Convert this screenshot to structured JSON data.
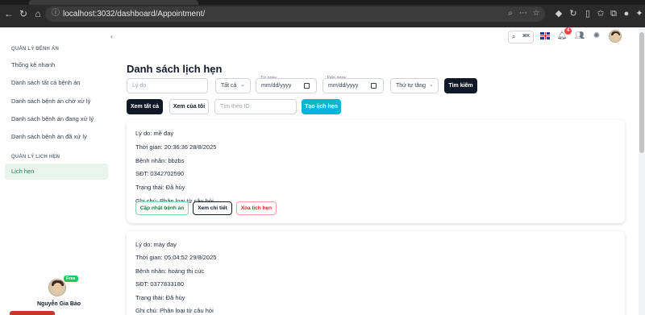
{
  "browser": {
    "url": "localhost:3032/dashboard/Appointment/"
  },
  "sidebar": {
    "sections": [
      {
        "title": "QUẢN LÝ BỆNH ÁN",
        "items": [
          {
            "label": "Thống kê nhanh"
          },
          {
            "label": "Danh sách tất cả bệnh án"
          },
          {
            "label": "Danh sách bệnh án chờ xử lý"
          },
          {
            "label": "Danh sách bệnh án đang xử lý"
          },
          {
            "label": "Danh sách bệnh án đã xử lý"
          }
        ]
      },
      {
        "title": "QUẢN LÝ LỊCH HẸN",
        "items": [
          {
            "label": "Lịch hẹn",
            "active": true
          }
        ]
      }
    ],
    "user": {
      "name": "Nguyễn Gia Bảo",
      "badge": "Free"
    }
  },
  "topbar": {
    "shortcut": "⌘K",
    "notification_count": "4",
    "icons": [
      "search-icon",
      "uk-flag-icon",
      "bell-icon",
      "contacts-icon",
      "settings-icon",
      "avatar"
    ]
  },
  "main": {
    "title": "Danh sách lịch hẹn",
    "filters": {
      "reason_placeholder": "Lý do",
      "status_value": "Tất cả",
      "from_label": "Từ ngày",
      "from_value": "mm/dd/yyyy",
      "to_label": "Đến ngày",
      "to_value": "mm/dd/yyyy",
      "order_value": "Thứ tự tăng",
      "search_button": "Tìm kiếm"
    },
    "actions": {
      "view_all": "Xem tất cả",
      "view_mine": "Xem của tôi",
      "id_placeholder": "Tìm theo ID",
      "create": "Tạo lịch hẹn"
    },
    "appointments": [
      {
        "reason": "Lý do: mề đay",
        "time": "Thời gian: 20:36:36 28/8/2025",
        "patient": "Bệnh nhân: bbzbs",
        "phone": "SĐT: 0342702590",
        "status": "Trạng thái: Đã hủy",
        "note": "Ghi chú: Phân loại từ câu hỏi",
        "buttons": {
          "update": "Cập nhật bệnh án",
          "detail": "Xem chi tiết",
          "delete": "Xóa lịch hẹn"
        }
      },
      {
        "reason": "Lý do: mày đay",
        "time": "Thời gian: 05:04:52 29/8/2025",
        "patient": "Bệnh nhân: hoàng thị cúc",
        "phone": "SĐT: 0377833180",
        "status": "Trạng thái: Đã hủy",
        "note": "Ghi chú: Phân loại từ câu hỏi"
      }
    ]
  },
  "colors": {
    "active_bg": "#eaf4ee",
    "active_text": "#1f7a4a",
    "primary_dark": "#111827",
    "create_button": "#06b6d4",
    "badge_green": "#22c55e",
    "notif_red": "#ef4444"
  }
}
